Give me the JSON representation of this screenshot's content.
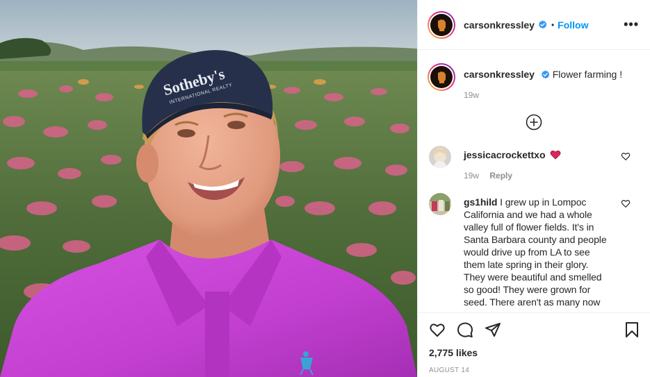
{
  "post": {
    "author": {
      "username": "carsonkressley",
      "verified": true,
      "follow_label": "Follow",
      "separator": "•",
      "more_label": "•••"
    },
    "caption": {
      "username": "carsonkressley",
      "text": "Flower farming !",
      "age": "19w"
    },
    "load_more_icon": "plus-circle-icon",
    "comments": [
      {
        "username": "jessicacrockettxo",
        "text": "",
        "emoji": "heart-emoji",
        "age": "19w",
        "reply_label": "Reply"
      },
      {
        "username": "gs1hild",
        "text": "I grew up in Lompoc California and we had a whole valley full of flower fields. It's in Santa Barbara county and people would drive up from LA to see them late spring in their glory. They were beautiful and smelled so good! They were grown for seed. There aren't as many now"
      }
    ],
    "actions": {
      "like_icon": "heart-icon",
      "comment_icon": "comment-icon",
      "share_icon": "paper-plane-icon",
      "save_icon": "bookmark-icon"
    },
    "likes": "2,775 likes",
    "date": "AUGUST 14"
  },
  "photo": {
    "cap_text_line1": "Sotheby's",
    "cap_text_line2": "INTERNATIONAL REALTY"
  },
  "colors": {
    "accent": "#0095f6",
    "shirt": "#c23fd0",
    "cap": "#26304a",
    "flowers": "#d8638a"
  }
}
